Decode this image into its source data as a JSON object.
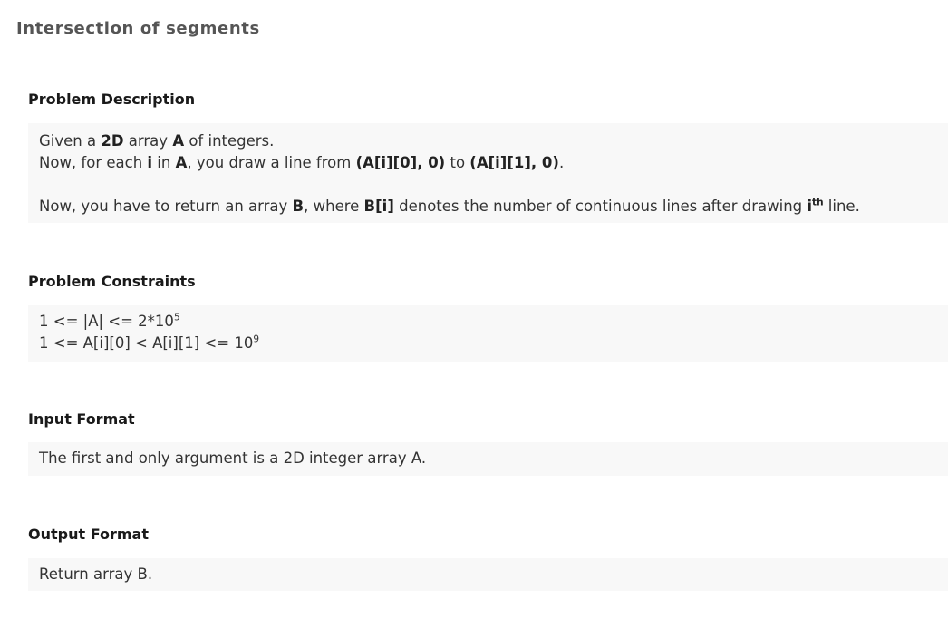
{
  "title": "Intersection of segments",
  "sections": {
    "description": {
      "heading": "Problem Description",
      "line1": {
        "t1": "Given a ",
        "b1": "2D",
        "t2": " array ",
        "b2": "A",
        "t3": " of integers."
      },
      "line2": {
        "t1": "Now, for each ",
        "b1": "i",
        "t2": " in ",
        "b2": "A",
        "t3": ", you draw a line from ",
        "b3": "(A[i][0], 0)",
        "t4": " to ",
        "b4": "(A[i][1], 0)",
        "t5": "."
      },
      "line3": {
        "t1": "Now, you have to return an array ",
        "b1": "B",
        "t2": ", where ",
        "b2": "B[i]",
        "t3": " denotes the number of continuous lines after drawing ",
        "b3": "i",
        "sup": "th",
        "t4": " line."
      }
    },
    "constraints": {
      "heading": "Problem Constraints",
      "line1": {
        "base": "1 <= |A| <= 2*10",
        "exp": "5"
      },
      "line2": {
        "base": "1 <= A[i][0] < A[i][1] <= 10",
        "exp": "9"
      }
    },
    "input": {
      "heading": "Input Format",
      "text": "The first and only argument is a 2D integer array A."
    },
    "output": {
      "heading": "Output Format",
      "text": "Return array B."
    }
  }
}
